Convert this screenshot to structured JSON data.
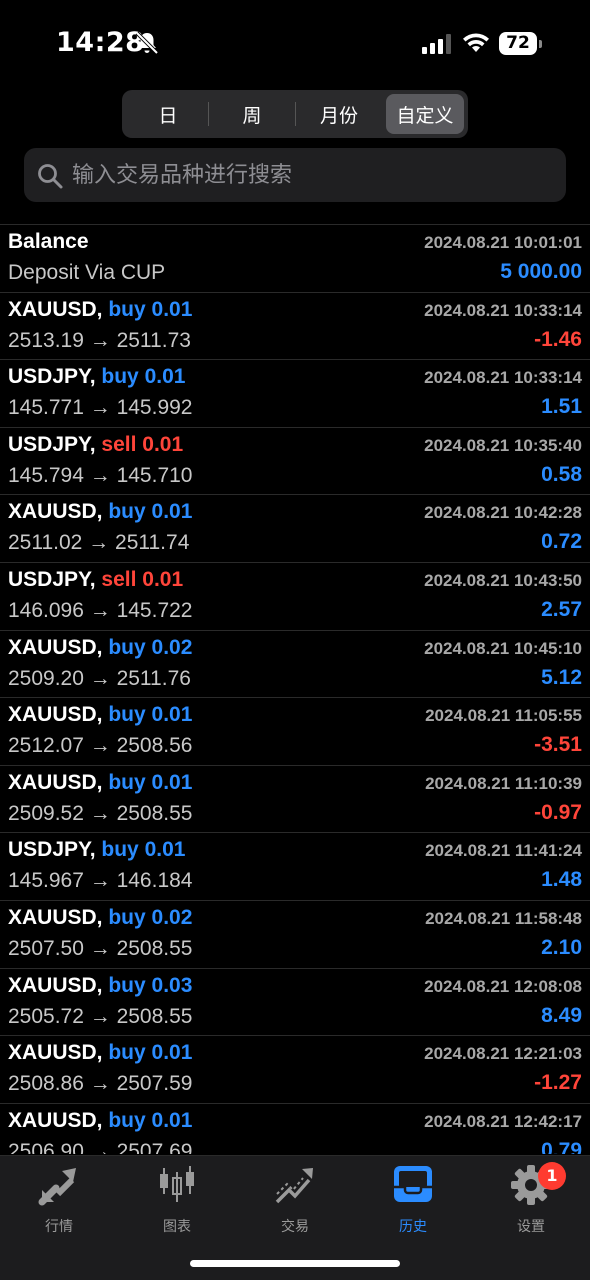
{
  "status": {
    "time": "14:28",
    "battery": "72"
  },
  "period_tabs": [
    {
      "label": "日",
      "active": false
    },
    {
      "label": "周",
      "active": false
    },
    {
      "label": "月份",
      "active": false
    },
    {
      "label": "自定义",
      "active": true
    }
  ],
  "search": {
    "placeholder": "输入交易品种进行搜索"
  },
  "deals": [
    {
      "symbol": "Balance",
      "side": "",
      "volume": "",
      "prices": "Deposit Via CUP",
      "date": "2024.08.21 10:01:01",
      "profit": "5 000.00",
      "sign": "pos"
    },
    {
      "symbol": "XAUUSD,",
      "side": "buy",
      "volume": "0.01",
      "prices": "2513.19 → 2511.73",
      "date": "2024.08.21 10:33:14",
      "profit": "-1.46",
      "sign": "neg"
    },
    {
      "symbol": "USDJPY,",
      "side": "buy",
      "volume": "0.01",
      "prices": "145.771 → 145.992",
      "date": "2024.08.21 10:33:14",
      "profit": "1.51",
      "sign": "pos"
    },
    {
      "symbol": "USDJPY,",
      "side": "sell",
      "volume": "0.01",
      "prices": "145.794 → 145.710",
      "date": "2024.08.21 10:35:40",
      "profit": "0.58",
      "sign": "pos"
    },
    {
      "symbol": "XAUUSD,",
      "side": "buy",
      "volume": "0.01",
      "prices": "2511.02 → 2511.74",
      "date": "2024.08.21 10:42:28",
      "profit": "0.72",
      "sign": "pos"
    },
    {
      "symbol": "USDJPY,",
      "side": "sell",
      "volume": "0.01",
      "prices": "146.096 → 145.722",
      "date": "2024.08.21 10:43:50",
      "profit": "2.57",
      "sign": "pos"
    },
    {
      "symbol": "XAUUSD,",
      "side": "buy",
      "volume": "0.02",
      "prices": "2509.20 → 2511.76",
      "date": "2024.08.21 10:45:10",
      "profit": "5.12",
      "sign": "pos"
    },
    {
      "symbol": "XAUUSD,",
      "side": "buy",
      "volume": "0.01",
      "prices": "2512.07 → 2508.56",
      "date": "2024.08.21 11:05:55",
      "profit": "-3.51",
      "sign": "neg"
    },
    {
      "symbol": "XAUUSD,",
      "side": "buy",
      "volume": "0.01",
      "prices": "2509.52 → 2508.55",
      "date": "2024.08.21 11:10:39",
      "profit": "-0.97",
      "sign": "neg"
    },
    {
      "symbol": "USDJPY,",
      "side": "buy",
      "volume": "0.01",
      "prices": "145.967 → 146.184",
      "date": "2024.08.21 11:41:24",
      "profit": "1.48",
      "sign": "pos"
    },
    {
      "symbol": "XAUUSD,",
      "side": "buy",
      "volume": "0.02",
      "prices": "2507.50 → 2508.55",
      "date": "2024.08.21 11:58:48",
      "profit": "2.10",
      "sign": "pos"
    },
    {
      "symbol": "XAUUSD,",
      "side": "buy",
      "volume": "0.03",
      "prices": "2505.72 → 2508.55",
      "date": "2024.08.21 12:08:08",
      "profit": "8.49",
      "sign": "pos"
    },
    {
      "symbol": "XAUUSD,",
      "side": "buy",
      "volume": "0.01",
      "prices": "2508.86 → 2507.59",
      "date": "2024.08.21 12:21:03",
      "profit": "-1.27",
      "sign": "neg"
    },
    {
      "symbol": "XAUUSD,",
      "side": "buy",
      "volume": "0.01",
      "prices": "2506.90 → 2507.69",
      "date": "2024.08.21 12:42:17",
      "profit": "0.79",
      "sign": "pos"
    }
  ],
  "tabbar": [
    {
      "label": "行情",
      "icon": "quotes-arrows-icon",
      "active": false
    },
    {
      "label": "图表",
      "icon": "candlestick-chart-icon",
      "active": false
    },
    {
      "label": "交易",
      "icon": "trade-trend-icon",
      "active": false
    },
    {
      "label": "历史",
      "icon": "history-inbox-icon",
      "active": true
    },
    {
      "label": "设置",
      "icon": "gear-icon",
      "active": false,
      "badge": "1"
    }
  ],
  "colors": {
    "buy": "#2b8cff",
    "sell": "#ff453a",
    "active_tab": "#2b8cff",
    "badge": "#ff3b30"
  }
}
